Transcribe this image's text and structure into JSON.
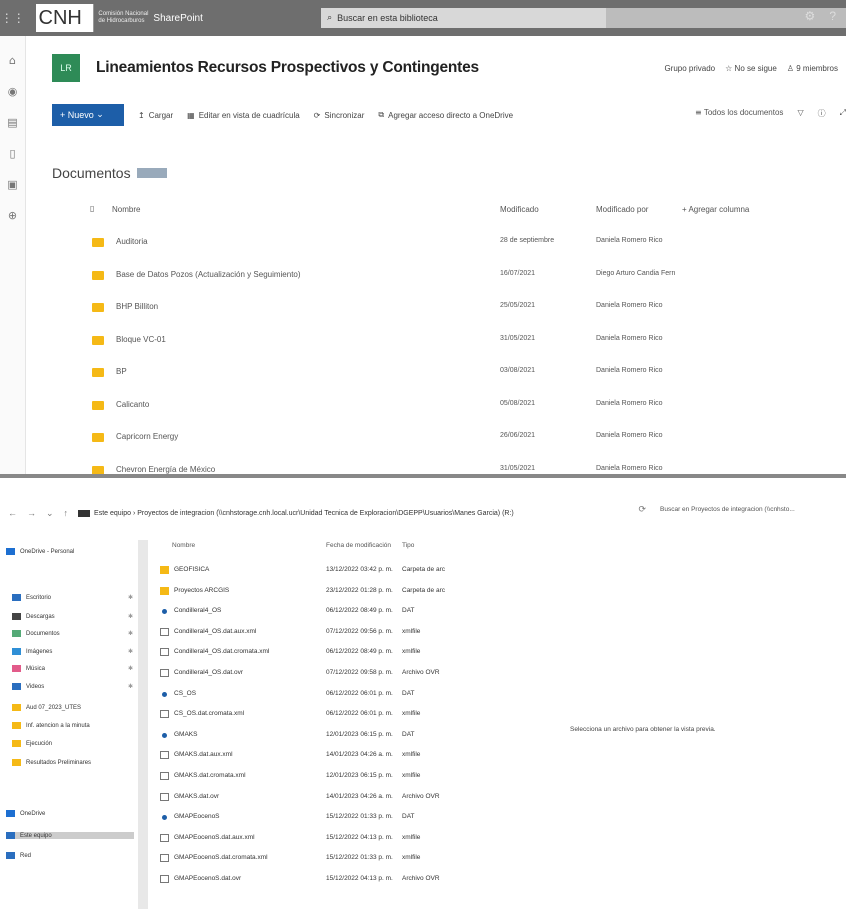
{
  "sharepoint": {
    "topbar": {
      "logo": "CNH",
      "org_text": "Comisión Nacional de Hidrocarburos",
      "brand": "SharePoint",
      "search_placeholder": "Buscar en esta biblioteca"
    },
    "site": {
      "icon_text": "LR",
      "title": "Lineamientos Recursos Prospectivos y Contingentes",
      "privacy": "Grupo privado",
      "follow": "No se sigue",
      "members": "9 miembros"
    },
    "commands": {
      "new": "+ Nuevo",
      "upload": "Cargar",
      "grid": "Editar en vista de cuadrícula",
      "sync": "Sincronizar",
      "shortcut": "Agregar acceso directo a OneDrive",
      "view": "Todos los documentos"
    },
    "library_title": "Documentos",
    "columns": {
      "name": "Nombre",
      "modified": "Modificado",
      "modified_by": "Modificado por",
      "add": "+ Agregar columna"
    },
    "rows": [
      {
        "name": "Auditoria",
        "modified": "28 de septiembre",
        "by": "Daniela Romero Rico"
      },
      {
        "name": "Base de Datos Pozos (Actualización y Seguimiento)",
        "modified": "16/07/2021",
        "by": "Diego Arturo Candia Fern"
      },
      {
        "name": "BHP Billiton",
        "modified": "25/05/2021",
        "by": "Daniela Romero Rico"
      },
      {
        "name": "Bloque VC-01",
        "modified": "31/05/2021",
        "by": "Daniela Romero Rico"
      },
      {
        "name": "BP",
        "modified": "03/08/2021",
        "by": "Daniela Romero Rico"
      },
      {
        "name": "Calicanto",
        "modified": "05/08/2021",
        "by": "Daniela Romero Rico"
      },
      {
        "name": "Capricorn Energy",
        "modified": "26/06/2021",
        "by": "Daniela Romero Rico"
      },
      {
        "name": "Chevron Energía de México",
        "modified": "31/05/2021",
        "by": "Daniela Romero Rico"
      }
    ]
  },
  "explorer": {
    "path": "Este equipo  ›  Proyectos de integracion (\\\\cnhstorage.cnh.local.ucr\\Unidad Tecnica de Exploracion\\DGEPP\\Usuarios\\Manes Garcia) (R:)",
    "search_placeholder": "Buscar en Proyectos de integracion (\\\\cnhsto...",
    "tree": [
      "OneDrive - Personal",
      "Escritorio",
      "Descargas",
      "Documentos",
      "Imágenes",
      "Música",
      "Videos",
      "Aud 07_2023_UTES",
      "Inf. atencion a la minuta",
      "Ejecución",
      "Resultados Preliminares",
      "OneDrive",
      "Este equipo",
      "Red"
    ],
    "columns": {
      "name": "Nombre",
      "date": "Fecha de modificación",
      "type": "Tipo"
    },
    "files": [
      {
        "name": "GEOFISICA",
        "date": "13/12/2022 03:42 p. m.",
        "type": "Carpeta de arc",
        "kind": "folder"
      },
      {
        "name": "Proyectos ARCGIS",
        "date": "23/12/2022 01:28 p. m.",
        "type": "Carpeta de arc",
        "kind": "folder"
      },
      {
        "name": "Condilleral4_OS",
        "date": "06/12/2022 08:49 p. m.",
        "type": "DAT",
        "kind": "dat"
      },
      {
        "name": "Condilleral4_OS.dat.aux.xml",
        "date": "07/12/2022 09:56 p. m.",
        "type": "xmlfile",
        "kind": "file"
      },
      {
        "name": "Condilleral4_OS.dat.cromata.xml",
        "date": "06/12/2022 08:49 p. m.",
        "type": "xmlfile",
        "kind": "file"
      },
      {
        "name": "Condilleral4_OS.dat.ovr",
        "date": "07/12/2022 09:58 p. m.",
        "type": "Archivo OVR",
        "kind": "file"
      },
      {
        "name": "CS_OS",
        "date": "06/12/2022 06:01 p. m.",
        "type": "DAT",
        "kind": "dat"
      },
      {
        "name": "CS_OS.dat.cromata.xml",
        "date": "06/12/2022 06:01 p. m.",
        "type": "xmlfile",
        "kind": "file"
      },
      {
        "name": "GMAKS",
        "date": "12/01/2023 06:15 p. m.",
        "type": "DAT",
        "kind": "dat"
      },
      {
        "name": "GMAKS.dat.aux.xml",
        "date": "14/01/2023 04:26 a. m.",
        "type": "xmlfile",
        "kind": "file"
      },
      {
        "name": "GMAKS.dat.cromata.xml",
        "date": "12/01/2023 06:15 p. m.",
        "type": "xmlfile",
        "kind": "file"
      },
      {
        "name": "GMAKS.dat.ovr",
        "date": "14/01/2023 04:26 a. m.",
        "type": "Archivo OVR",
        "kind": "file"
      },
      {
        "name": "GMAPEocenoS",
        "date": "15/12/2022 01:33 p. m.",
        "type": "DAT",
        "kind": "dat"
      },
      {
        "name": "GMAPEocenoS.dat.aux.xml",
        "date": "15/12/2022 04:13 p. m.",
        "type": "xmlfile",
        "kind": "file"
      },
      {
        "name": "GMAPEocenoS.dat.cromata.xml",
        "date": "15/12/2022 01:33 p. m.",
        "type": "xmlfile",
        "kind": "file"
      },
      {
        "name": "GMAPEocenoS.dat.ovr",
        "date": "15/12/2022 04:13 p. m.",
        "type": "Archivo OVR",
        "kind": "file"
      }
    ],
    "preview_text": "Selecciona un archivo para obtener la vista previa."
  }
}
